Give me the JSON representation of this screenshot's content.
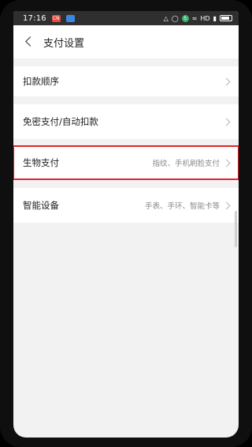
{
  "status_bar": {
    "time": "17:16",
    "badge_red": "CN",
    "right_text": "HD",
    "circle_num": "5",
    "icons": [
      "mute-icon",
      "alarm-icon",
      "wifi-icon",
      "signal-icon",
      "battery-icon"
    ]
  },
  "header": {
    "title": "支付设置"
  },
  "settings": {
    "items": [
      {
        "label": "扣款顺序",
        "value": ""
      },
      {
        "label": "免密支付/自动扣款",
        "value": ""
      },
      {
        "label": "生物支付",
        "value": "指纹、手机刷脸支付"
      },
      {
        "label": "智能设备",
        "value": "手表、手环、智能卡等"
      }
    ]
  },
  "colors": {
    "highlight": "#e5222c",
    "status_bar": "#2f2f2f"
  }
}
